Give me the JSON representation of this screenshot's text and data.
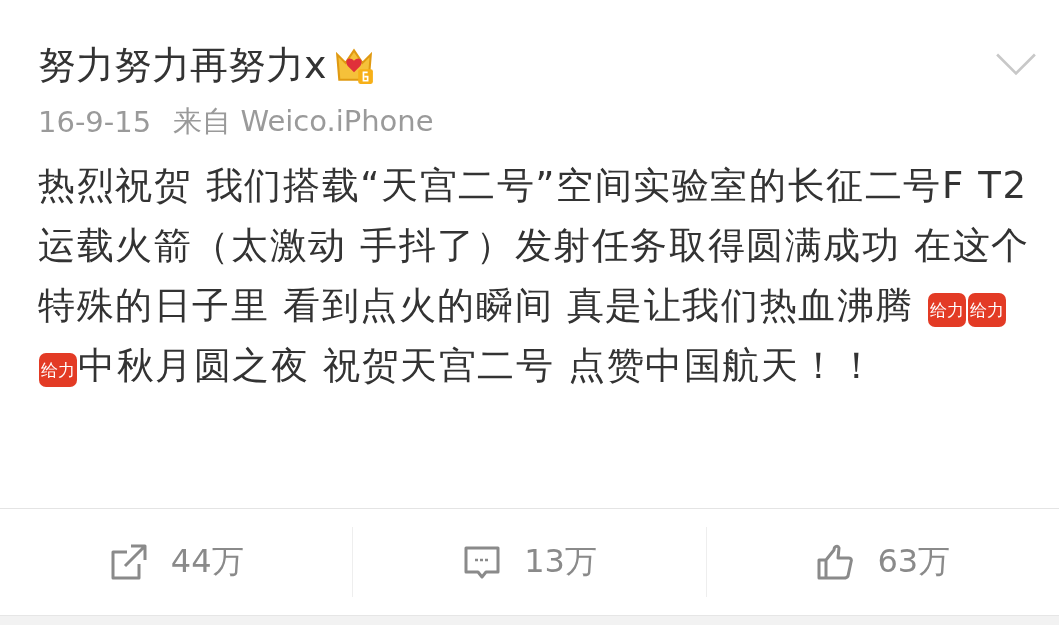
{
  "post": {
    "author": "努力努力再努力x",
    "date": "16-9-15",
    "source": "来自 Weico.iPhone",
    "body": [
      {
        "kind": "text",
        "text": "热烈祝贺 我们搭载“天宫二号”空间实验室的长征二号F T2运载火箭（太激动 手抖了）发射任务取得圆满成功 在这个特殊的日子里 看到点火的瞬间 真是让我们热血沸腾 "
      },
      {
        "kind": "emoji",
        "text": "给力"
      },
      {
        "kind": "emoji",
        "text": "给力"
      },
      {
        "kind": "emoji",
        "text": "给力"
      },
      {
        "kind": "text",
        "text": "中秋月圆之夜 祝贺天宫二号 点赞中国航天！！"
      }
    ]
  },
  "actions": [
    {
      "kind": "repost",
      "count": "44万"
    },
    {
      "kind": "comment",
      "count": "13万"
    },
    {
      "kind": "like",
      "count": "63万"
    }
  ]
}
